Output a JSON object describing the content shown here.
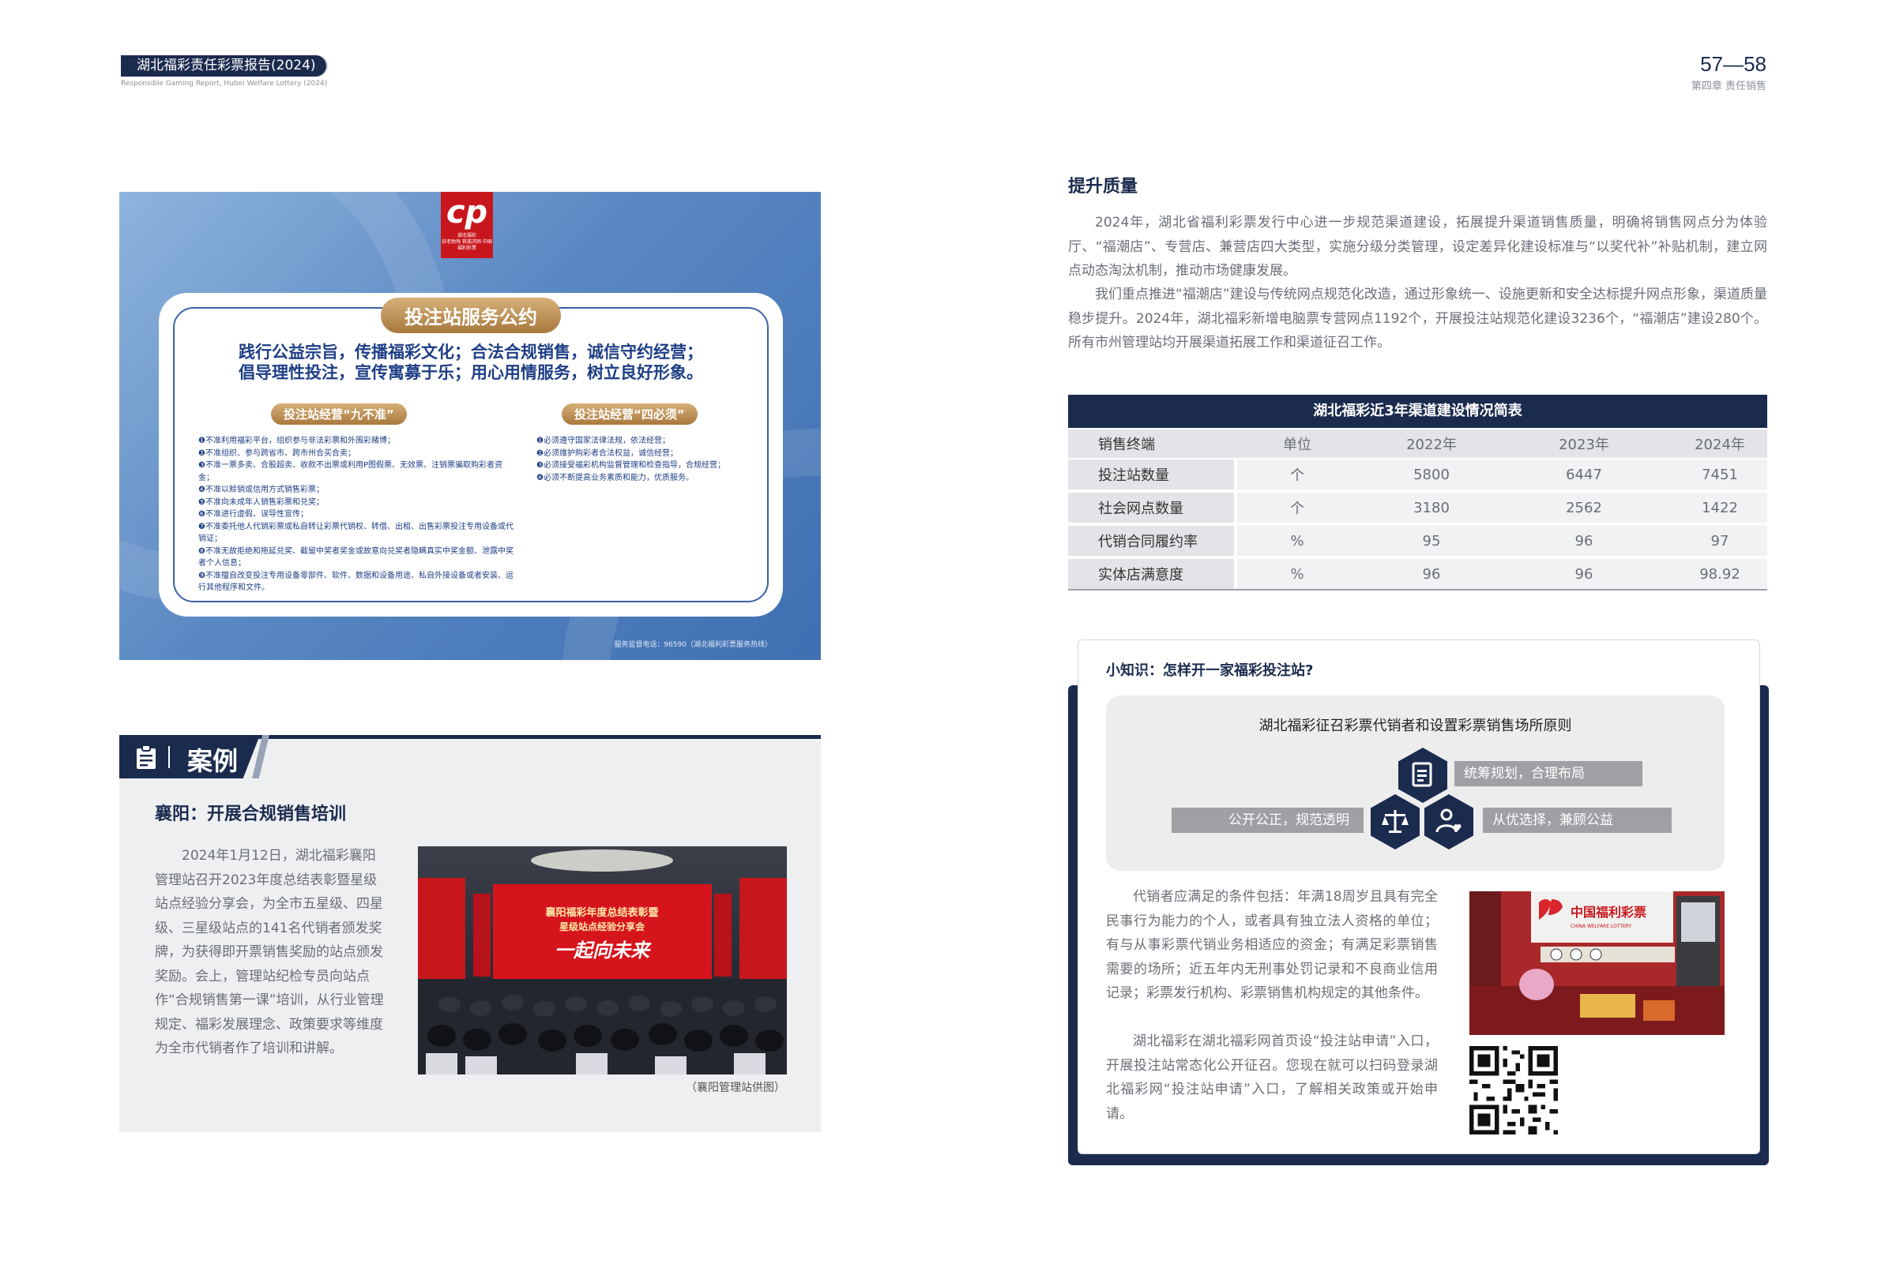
{
  "header": {
    "report_title": "湖北福彩责任彩票报告(2024)",
    "report_title_en": "Responsible Gaming Report, Hubei Welfare Lottery (2024)",
    "page_numbers": "57—58",
    "chapter": "第四章 责任销售"
  },
  "promise_board": {
    "logo_caption": "湖北福彩\n扶老助残 救孤济困 中国福利彩票",
    "title": "投注站服务公约",
    "motto_line1": "践行公益宗旨，传播福彩文化；合法合规销售，诚信守约经营；",
    "motto_line2": "倡导理性投注，宣传寓募于乐；用心用情服务，树立良好形象。",
    "left_heading": "投注站经营“九不准”",
    "left_rules": [
      "❶不准利用福彩平台，组织参与非法彩票和外围彩赌博；",
      "❷不准组织、参与跨省市、跨市州合买合卖；",
      "❸不准一票多卖、合股超卖、收款不出票或利用P图假票、无效票、注销票骗取购彩者资金；",
      "❹不准以赊销或信用方式销售彩票；",
      "❺不准向未成年人销售彩票和兑奖；",
      "❻不准进行虚假、误导性宣传；",
      "❼不准委托他人代销彩票或私自转让彩票代销权、转借、出租、出售彩票投注专用设备或代销证；",
      "❽不准无故拒绝和拖延兑奖、截留中奖者奖金或故意向兑奖者隐瞒真实中奖金额、泄露中奖者个人信息；",
      "❾不准擅自改变投注专用设备零部件、软件、数据和设备用途、私自外接设备或者安装、运行其他程序和文件。"
    ],
    "right_heading": "投注站经营“四必须”",
    "right_rules": [
      "❶必须遵守国家法律法规，依法经营；",
      "❷必须维护购彩者合法权益，诚信经营；",
      "❸必须接受福彩机构监督管理和检查指导，合规经营；",
      "❹必须不断提高业务素质和能力，优质服务。"
    ],
    "footer": "服务监督电话：96590（湖北福利彩票服务热线）"
  },
  "case": {
    "label": "案例",
    "title": "襄阳：开展合规销售培训",
    "text": "2024年1月12日，湖北福彩襄阳管理站召开2023年度总结表彰暨星级站点经验分享会，为全市五星级、四星级、三星级站点的141名代销者颁发奖牌，为获得即开票销售奖励的站点颁发奖励。会上，管理站纪检专员向站点作“合规销售第一课”培训，从行业管理规定、福彩发展理念、政策要求等维度为全市代销者作了培训和讲解。",
    "photo_banner_line1": "襄阳福彩年度总结表彰暨",
    "photo_banner_line2": "星级站点经验分享会",
    "photo_slogan": "一起向未来",
    "caption": "（襄阳管理站供图）"
  },
  "quality": {
    "title": "提升质量",
    "para1": "2024年，湖北省福利彩票发行中心进一步规范渠道建设，拓展提升渠道销售质量，明确将销售网点分为体验厅、“福潮店”、专营店、兼营店四大类型，实施分级分类管理，设定差异化建设标准与“以奖代补”补贴机制，建立网点动态淘汰机制，推动市场健康发展。",
    "para2": "我们重点推进“福潮店”建设与传统网点规范化改造，通过形象统一、设施更新和安全达标提升网点形象，渠道质量稳步提升。2024年，湖北福彩新增电脑票专营网点1192个，开展投注站规范化建设3236个，“福潮店”建设280个。所有市州管理站均开展渠道拓展工作和渠道征召工作。"
  },
  "table": {
    "title": "湖北福彩近3年渠道建设情况简表",
    "headers": [
      "销售终端",
      "单位",
      "2022年",
      "2023年",
      "2024年"
    ],
    "rows": [
      {
        "name": "投注站数量",
        "unit": "个",
        "y2022": "5800",
        "y2023": "6447",
        "y2024": "7451"
      },
      {
        "name": "社会网点数量",
        "unit": "个",
        "y2022": "3180",
        "y2023": "2562",
        "y2024": "1422"
      },
      {
        "name": "代销合同履约率",
        "unit": "%",
        "y2022": "95",
        "y2023": "96",
        "y2024": "97"
      },
      {
        "name": "实体店满意度",
        "unit": "%",
        "y2022": "96",
        "y2023": "96",
        "y2024": "98.92"
      }
    ]
  },
  "knowledge": {
    "title": "小知识：怎样开一家福彩投注站?",
    "panel_title": "湖北福彩征召彩票代销者和设置彩票销售场所原则",
    "principle_1": "统筹规划，合理布局",
    "principle_2": "公开公正，规范透明",
    "principle_3": "从优选择，兼顾公益",
    "para1": "代销者应满足的条件包括：年满18周岁且具有完全民事行为能力的个人，或者具有独立法人资格的单位；有与从事彩票代销业务相适应的资金；有满足彩票销售需要的场所；近五年内无刑事处罚记录和不良商业信用记录；彩票发行机构、彩票销售机构规定的其他条件。",
    "para2": "湖北福彩在湖北福彩网首页设“投注站申请”入口，开展投注站常态化公开征召。您现在就可以扫码登录湖北福彩网“投注站申请”入口，了解相关政策或开始申请。",
    "photo_sign": "中国福利彩票",
    "photo_sign_en": "CHINA WELFARE LOTTERY"
  }
}
